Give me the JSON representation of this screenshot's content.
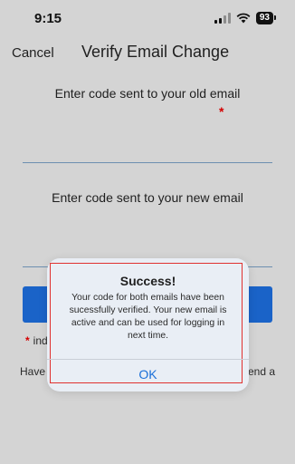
{
  "status": {
    "time": "9:15",
    "battery": "93"
  },
  "nav": {
    "cancel": "Cancel",
    "title": "Verify Email Change"
  },
  "form": {
    "old_prompt": "Enter code sent to your old email",
    "new_prompt": "Enter code sent to your new email",
    "required_mark": "*",
    "note_text": "ind",
    "have_text": "Have",
    "have_tail": "end a"
  },
  "dialog": {
    "title": "Success!",
    "message": "Your code for both emails have been sucessfully verified. Your new email is active and can be used for logging in next time.",
    "ok": "OK"
  },
  "colors": {
    "accent": "#1a6fd8",
    "button": "#1a63c8",
    "required": "#d40000",
    "highlight": "#e0312f"
  }
}
